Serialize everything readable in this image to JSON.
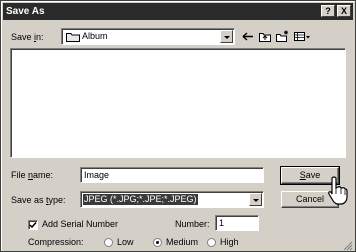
{
  "window": {
    "title": "Save As",
    "help_glyph": "?",
    "close_glyph": "X"
  },
  "save_in": {
    "label_prefix": "Save ",
    "label_accel": "i",
    "label_suffix": "n:",
    "folder": "Album",
    "folder_icon": "folder-icon"
  },
  "toolbar": {
    "icons": [
      "back-arrow-icon",
      "up-folder-icon",
      "new-folder-icon",
      "view-menu-icon"
    ]
  },
  "file_name": {
    "label_prefix": "File ",
    "label_accel": "n",
    "label_suffix": "ame:",
    "value": "Image"
  },
  "save_as_type": {
    "label_prefix": "Save as ",
    "label_accel": "t",
    "label_suffix": "ype:",
    "value": "JPEG (*.JPG;*.JPE;*.JPEG)"
  },
  "buttons": {
    "save_accel": "S",
    "save_rest": "ave",
    "cancel": "Cancel"
  },
  "serial": {
    "label": "Add Serial Number",
    "checked": true
  },
  "number": {
    "label": "Number:",
    "value": "1"
  },
  "compression": {
    "label": "Compression:",
    "options": [
      "Low",
      "Medium",
      "High"
    ],
    "selected": "Medium"
  },
  "colors": {
    "titlebar": "#2b2b2b",
    "face": "#d4d0c8",
    "selection": "#3a3a3a"
  }
}
